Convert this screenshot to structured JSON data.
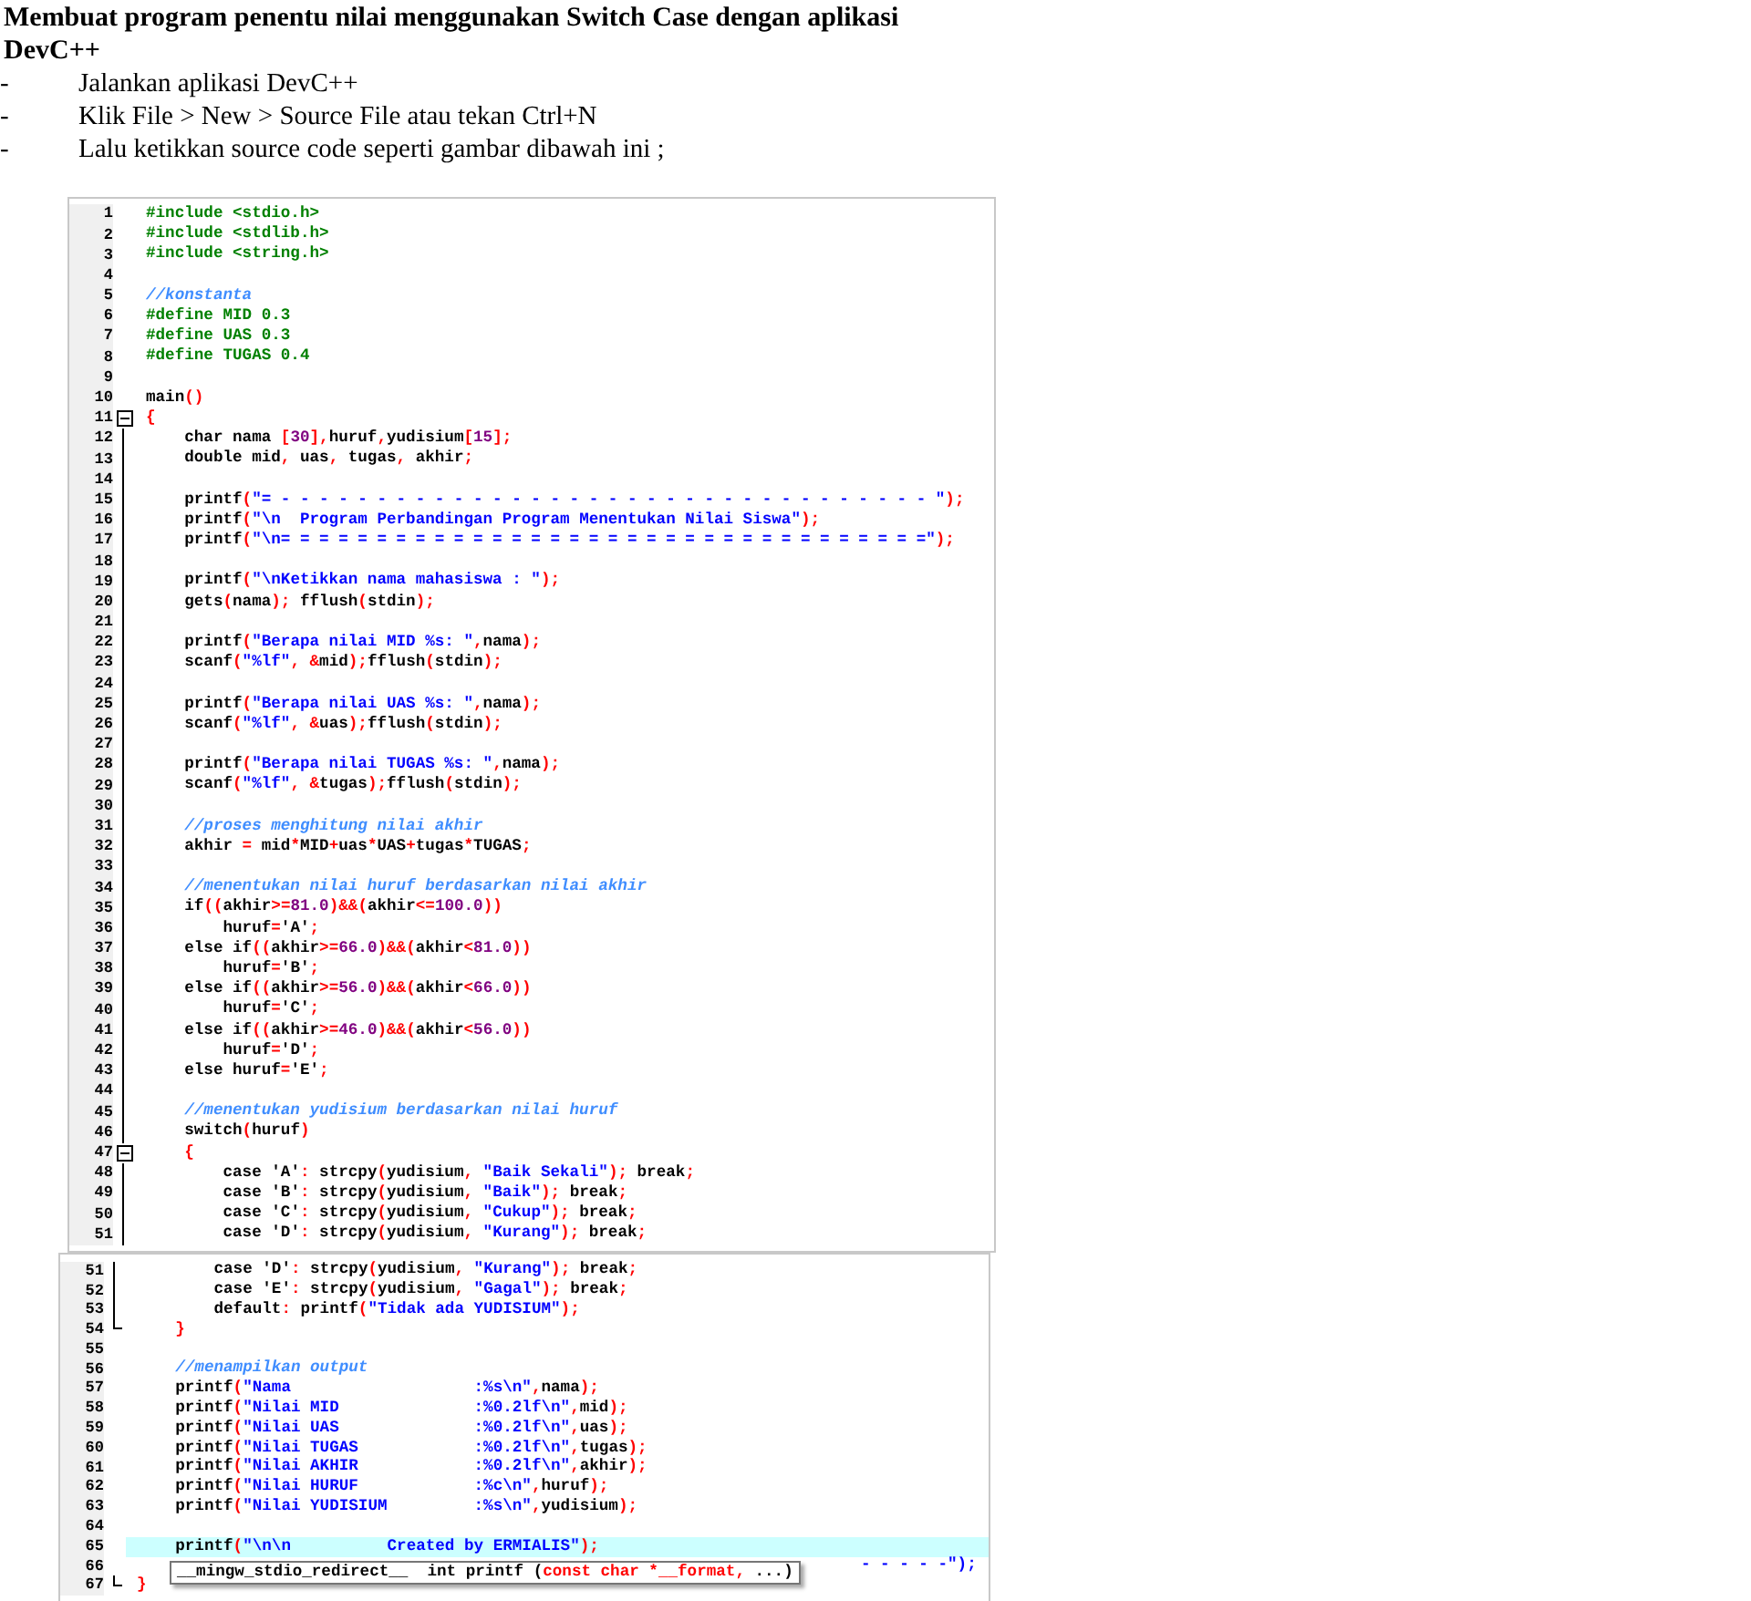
{
  "heading": "Membuat program penentu nilai menggunakan Switch Case dengan aplikasi DevC++",
  "steps": [
    {
      "bullet": "-",
      "text": "Jalankan aplikasi DevC++"
    },
    {
      "bullet": "-",
      "text": "Klik File > New > Source File atau tekan Ctrl+N"
    },
    {
      "bullet": "-",
      "text": "Lalu ketikkan source code seperti gambar dibawah ini ;"
    }
  ],
  "panels": [
    {
      "continued": false,
      "lines": [
        {
          "n": "1",
          "text": "#include <stdio.h>",
          "kind": "directive"
        },
        {
          "n": "2",
          "text": "#include <stdlib.h>",
          "kind": "directive"
        },
        {
          "n": "3",
          "text": "#include <string.h>",
          "kind": "directive"
        },
        {
          "n": "4",
          "kind": "code"
        },
        {
          "n": "5",
          "text": "//konstanta",
          "kind": "comment"
        },
        {
          "n": "6",
          "text": "#define MID 0.3",
          "kind": "directive"
        },
        {
          "n": "7",
          "text": "#define UAS 0.3",
          "kind": "directive"
        },
        {
          "n": "8",
          "text": "#define TUGAS 0.4",
          "kind": "directive"
        },
        {
          "n": "9",
          "kind": "code"
        },
        {
          "n": "10",
          "text": "main()",
          "kind": "code"
        },
        {
          "n": "11",
          "text": "{",
          "kind": "code",
          "fold_start": true
        },
        {
          "n": "12",
          "text": "    char nama [30],huruf,yudisium[15];",
          "kind": "code"
        },
        {
          "n": "13",
          "text": "    double mid, uas, tugas, akhir;",
          "kind": "code"
        },
        {
          "n": "14",
          "kind": "code"
        },
        {
          "n": "15",
          "text": "    printf(\"= - - - - - - - - - - - - - - - - - - - - - - - - - - - - - - - - - - \");",
          "kind": "code"
        },
        {
          "n": "16",
          "text": "    printf(\"\\n  Program Perbandingan Program Menentukan Nilai Siswa\");",
          "kind": "code"
        },
        {
          "n": "17",
          "text": "    printf(\"\\n= = = = = = = = = = = = = = = = = = = = = = = = = = = = = = = = = =\");",
          "kind": "code"
        },
        {
          "n": "18",
          "kind": "code"
        },
        {
          "n": "19",
          "text": "    printf(\"\\nKetikkan nama mahasiswa : \");",
          "kind": "code"
        },
        {
          "n": "20",
          "text": "    gets(nama); fflush(stdin);",
          "kind": "code"
        },
        {
          "n": "21",
          "kind": "code"
        },
        {
          "n": "22",
          "text": "    printf(\"Berapa nilai MID %s: \",nama);",
          "kind": "code"
        },
        {
          "n": "23",
          "text": "    scanf(\"%lf\", &mid);fflush(stdin);",
          "kind": "code"
        },
        {
          "n": "24",
          "kind": "code"
        },
        {
          "n": "25",
          "text": "    printf(\"Berapa nilai UAS %s: \",nama);",
          "kind": "code"
        },
        {
          "n": "26",
          "text": "    scanf(\"%lf\", &uas);fflush(stdin);",
          "kind": "code"
        },
        {
          "n": "27",
          "kind": "code"
        },
        {
          "n": "28",
          "text": "    printf(\"Berapa nilai TUGAS %s: \",nama);",
          "kind": "code"
        },
        {
          "n": "29",
          "text": "    scanf(\"%lf\", &tugas);fflush(stdin);",
          "kind": "code"
        },
        {
          "n": "30",
          "kind": "code"
        },
        {
          "n": "31",
          "text": "    //proses menghitung nilai akhir",
          "kind": "comment"
        },
        {
          "n": "32",
          "text": "    akhir = mid*MID+uas*UAS+tugas*TUGAS;",
          "kind": "code"
        },
        {
          "n": "33",
          "kind": "code"
        },
        {
          "n": "34",
          "text": "    //menentukan nilai huruf berdasarkan nilai akhir",
          "kind": "comment"
        },
        {
          "n": "35",
          "text": "    if((akhir>=81.0)&&(akhir<=100.0))",
          "kind": "code"
        },
        {
          "n": "36",
          "text": "        huruf='A';",
          "kind": "code"
        },
        {
          "n": "37",
          "text": "    else if((akhir>=66.0)&&(akhir<81.0))",
          "kind": "code"
        },
        {
          "n": "38",
          "text": "        huruf='B';",
          "kind": "code"
        },
        {
          "n": "39",
          "text": "    else if((akhir>=56.0)&&(akhir<66.0))",
          "kind": "code"
        },
        {
          "n": "40",
          "text": "        huruf='C';",
          "kind": "code"
        },
        {
          "n": "41",
          "text": "    else if((akhir>=46.0)&&(akhir<56.0))",
          "kind": "code"
        },
        {
          "n": "42",
          "text": "        huruf='D';",
          "kind": "code"
        },
        {
          "n": "43",
          "text": "    else huruf='E';",
          "kind": "code"
        },
        {
          "n": "44",
          "kind": "code"
        },
        {
          "n": "45",
          "text": "    //menentukan yudisium berdasarkan nilai huruf",
          "kind": "comment"
        },
        {
          "n": "46",
          "text": "    switch(huruf)",
          "kind": "code"
        },
        {
          "n": "47",
          "text": "    {",
          "kind": "code",
          "fold_start": true
        },
        {
          "n": "48",
          "text": "        case 'A': strcpy(yudisium, \"Baik Sekali\"); break;",
          "kind": "code"
        },
        {
          "n": "49",
          "text": "        case 'B': strcpy(yudisium, \"Baik\"); break;",
          "kind": "code"
        },
        {
          "n": "50",
          "text": "        case 'C': strcpy(yudisium, \"Cukup\"); break;",
          "kind": "code"
        },
        {
          "n": "51",
          "text": "        case 'D': strcpy(yudisium, \"Kurang\"); break;",
          "kind": "code"
        }
      ]
    },
    {
      "continued": true,
      "lines": [
        {
          "n": "51",
          "text": "        case 'D': strcpy(yudisium, \"Kurang\"); break;",
          "kind": "code"
        },
        {
          "n": "52",
          "text": "        case 'E': strcpy(yudisium, \"Gagal\"); break;",
          "kind": "code"
        },
        {
          "n": "53",
          "text": "        default: printf(\"Tidak ada YUDISIUM\");",
          "kind": "code"
        },
        {
          "n": "54",
          "text": "    }",
          "kind": "code",
          "fold_end": true
        },
        {
          "n": "55",
          "kind": "code"
        },
        {
          "n": "56",
          "text": "    //menampilkan output",
          "kind": "comment"
        },
        {
          "n": "57",
          "text": "    printf(\"Nama                   :%s\\n\",nama);",
          "kind": "code"
        },
        {
          "n": "58",
          "text": "    printf(\"Nilai MID              :%0.2lf\\n\",mid);",
          "kind": "code"
        },
        {
          "n": "59",
          "text": "    printf(\"Nilai UAS              :%0.2lf\\n\",uas);",
          "kind": "code"
        },
        {
          "n": "60",
          "text": "    printf(\"Nilai TUGAS            :%0.2lf\\n\",tugas);",
          "kind": "code"
        },
        {
          "n": "61",
          "text": "    printf(\"Nilai AKHIR            :%0.2lf\\n\",akhir);",
          "kind": "code"
        },
        {
          "n": "62",
          "text": "    printf(\"Nilai HURUF            :%c\\n\",huruf);",
          "kind": "code"
        },
        {
          "n": "63",
          "text": "    printf(\"Nilai YUDISIUM         :%s\\n\",yudisium);",
          "kind": "code"
        },
        {
          "n": "64",
          "kind": "code"
        },
        {
          "n": "65",
          "text": "    printf(\"\\n\\n          Created by ERMIALIS\");",
          "kind": "code",
          "current": true
        },
        {
          "n": "66",
          "text": "- - - - -\");",
          "kind": "covered"
        },
        {
          "n": "67",
          "text": "}",
          "kind": "code",
          "fold_end": true
        }
      ],
      "tooltip": {
        "prefix": "__mingw_stdio_redirect__  int printf (",
        "params": "const char *__format,",
        "suffix": " ...)"
      }
    }
  ]
}
